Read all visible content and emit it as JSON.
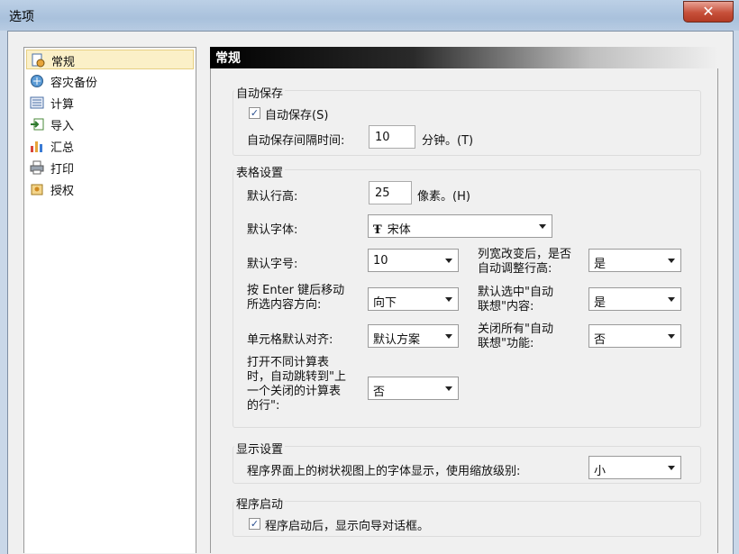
{
  "window": {
    "title": "选项",
    "close_glyph": "✕"
  },
  "sidebar": {
    "items": [
      {
        "label": "常规",
        "icon": "general-settings-icon",
        "selected": true
      },
      {
        "label": "容灾备份",
        "icon": "backup-icon"
      },
      {
        "label": "计算",
        "icon": "calculate-icon"
      },
      {
        "label": "导入",
        "icon": "import-icon"
      },
      {
        "label": "汇总",
        "icon": "summary-chart-icon"
      },
      {
        "label": "打印",
        "icon": "printer-icon"
      },
      {
        "label": "授权",
        "icon": "license-icon"
      }
    ]
  },
  "panel": {
    "title": "常规",
    "autosave": {
      "group_title": "自动保存",
      "checkbox_label": "自动保存(S)",
      "checked": true,
      "interval_label": "自动保存间隔时间:",
      "interval_value": "10",
      "interval_unit": "分钟。(T)"
    },
    "table": {
      "group_title": "表格设置",
      "row_height_label": "默认行高:",
      "row_height_value": "25",
      "row_height_unit": "像素。(H)",
      "font_label": "默认字体:",
      "font_icon": "Ŧ",
      "font_value": "宋体",
      "font_size_label": "默认字号:",
      "font_size_value": "10",
      "auto_adjust_label_1": "列宽改变后，是否",
      "auto_adjust_label_2": "自动调整行高:",
      "auto_adjust_value": "是",
      "enter_move_label_1": "按 Enter 键后移动",
      "enter_move_label_2": "所选内容方向:",
      "enter_move_value": "向下",
      "auto_select_label_1": "默认选中\"自动",
      "auto_select_label_2": "联想\"内容:",
      "auto_select_value": "是",
      "align_label": "单元格默认对齐:",
      "align_value": "默认方案",
      "close_assoc_label_1": "关闭所有\"自动",
      "close_assoc_label_2": "联想\"功能:",
      "close_assoc_value": "否",
      "jump_label_1": "打开不同计算表",
      "jump_label_2": "时，自动跳转到\"上",
      "jump_label_3": "一个关闭的计算表",
      "jump_label_4": "的行\":",
      "jump_value": "否"
    },
    "display": {
      "group_title": "显示设置",
      "zoom_label": "程序界面上的树状视图上的字体显示，使用缩放级别:",
      "zoom_value": "小"
    },
    "startup": {
      "group_title": "程序启动",
      "checkbox_label": "程序启动后，显示向导对话框。",
      "checked": true
    }
  }
}
